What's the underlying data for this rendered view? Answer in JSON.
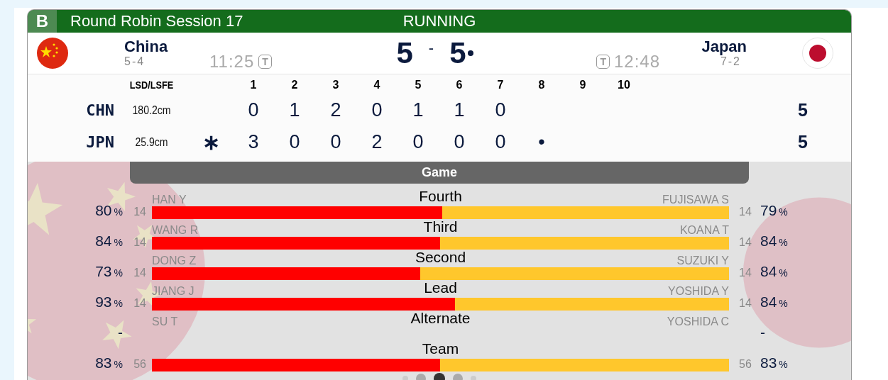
{
  "header": {
    "badge": "B",
    "title": "Round Robin Session 17",
    "status": "RUNNING"
  },
  "teams": [
    {
      "kind": "china",
      "name": "China",
      "record": "5-4",
      "clock": "11:25",
      "timeout": "T",
      "score": "5",
      "hammer": false
    },
    {
      "kind": "japan",
      "name": "Japan",
      "record": "7-2",
      "clock": "12:48",
      "timeout": "T",
      "score": "5",
      "hammer": true
    }
  ],
  "score_separator": "-",
  "linescore": {
    "columns": [
      "LSD/LSFE",
      "1",
      "2",
      "3",
      "4",
      "5",
      "6",
      "7",
      "8",
      "9",
      "10"
    ],
    "rows": [
      {
        "team": "CHN",
        "lsd": "180.2cm",
        "ends": [
          "0",
          "1",
          "2",
          "0",
          "1",
          "1",
          "0"
        ],
        "total": "5"
      },
      {
        "team": "JPN",
        "lsd": "25.9cm",
        "mark": "∗",
        "ends": [
          "3",
          "0",
          "0",
          "2",
          "0",
          "0",
          "0",
          "•"
        ],
        "total": "5"
      }
    ]
  },
  "tab": "Game",
  "players": [
    {
      "kind": "bar",
      "position": "Fourth",
      "level": 0.503,
      "left": {
        "name": "HAN Y",
        "count": "14",
        "percent": "80",
        "unit": "%"
      },
      "right": {
        "name": "FUJISAWA S",
        "count": "14",
        "percent": "79",
        "unit": "%"
      }
    },
    {
      "kind": "bar",
      "position": "Third",
      "level": 0.499,
      "left": {
        "name": "WANG R",
        "count": "14",
        "percent": "84",
        "unit": "%"
      },
      "right": {
        "name": "KOANA T",
        "count": "14",
        "percent": "84",
        "unit": "%"
      }
    },
    {
      "kind": "bar",
      "position": "Second",
      "level": 0.465,
      "left": {
        "name": "DONG Z",
        "count": "14",
        "percent": "73",
        "unit": "%"
      },
      "right": {
        "name": "SUZUKI Y",
        "count": "14",
        "percent": "84",
        "unit": "%"
      }
    },
    {
      "kind": "bar",
      "position": "Lead",
      "level": 0.525,
      "left": {
        "name": "JIANG J",
        "count": "14",
        "percent": "93",
        "unit": "%"
      },
      "right": {
        "name": "YOSHIDA Y",
        "count": "14",
        "percent": "84",
        "unit": "%"
      }
    },
    {
      "kind": "alternate",
      "position": "Alternate",
      "left": {
        "name": "SU T",
        "percent": "-"
      },
      "right": {
        "name": "YOSHIDA C",
        "percent": "-"
      }
    },
    {
      "kind": "bar",
      "position": "Team",
      "level": 0.499,
      "left": {
        "count": "56",
        "percent": "83",
        "unit": "%"
      },
      "right": {
        "count": "56",
        "percent": "83",
        "unit": "%"
      }
    }
  ],
  "pages": [
    {
      "selected": false
    },
    {
      "selected": false
    },
    {
      "selected": true
    },
    {
      "selected": false
    },
    {
      "selected": false
    }
  ]
}
